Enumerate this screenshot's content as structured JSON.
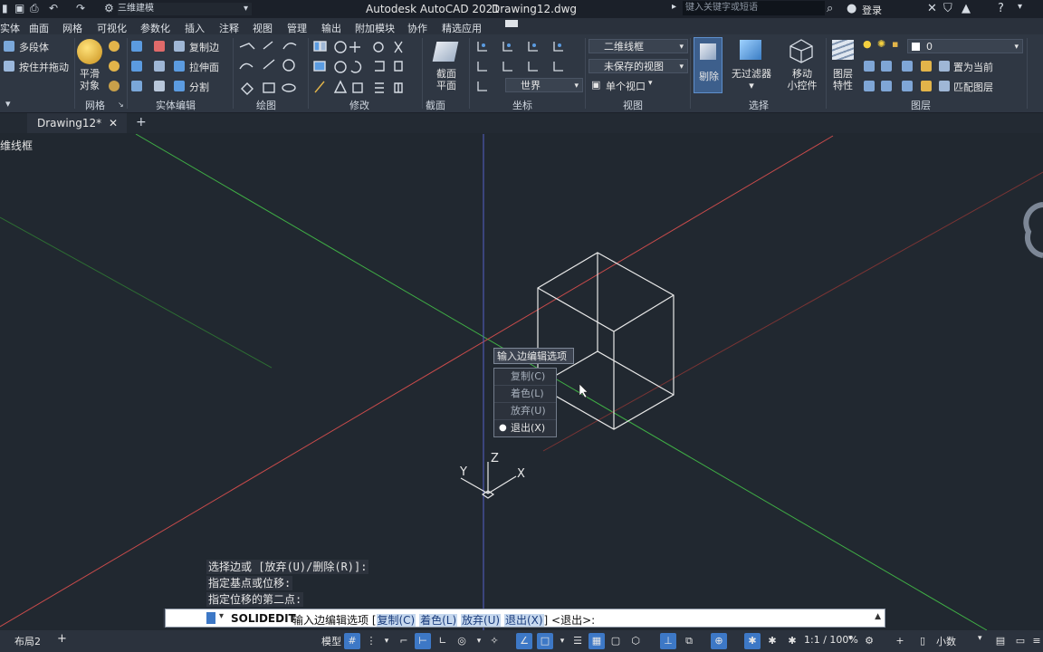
{
  "titlebar": {
    "workspace": "三维建模",
    "app_title": "Autodesk AutoCAD 2021",
    "document": "Drawing12.dwg",
    "search_placeholder": "键入关键字或短语",
    "login": "登录"
  },
  "menu_tabs": [
    "实体",
    "曲面",
    "网格",
    "可视化",
    "参数化",
    "插入",
    "注释",
    "视图",
    "管理",
    "输出",
    "附加模块",
    "协作",
    "精选应用"
  ],
  "ribbon": {
    "panel1": {
      "item1": "多段体",
      "item2": "按住并拖动"
    },
    "mesh": {
      "button_line1": "平滑",
      "button_line2": "对象",
      "title": "网格"
    },
    "solid_edit": {
      "copy_edge": "复制边",
      "extrude_face": "拉伸面",
      "split": "分割",
      "title": "实体编辑"
    },
    "draw_title": "绘图",
    "modify_title": "修改",
    "section": {
      "button_line1": "截面",
      "button_line2": "平面",
      "title": "截面"
    },
    "coords": {
      "ucs_value": "世界",
      "title": "坐标"
    },
    "view": {
      "visual_style": "二维线框",
      "saved_view": "未保存的视图",
      "viewport": "单个视口",
      "title": "视图"
    },
    "selection": {
      "cull": "剔除",
      "no_filter": "无过滤器",
      "gizmo_line1": "移动",
      "gizmo_line2": "小控件",
      "title": "选择"
    },
    "layers": {
      "props_line1": "图层",
      "props_line2": "特性",
      "layer_value": "0",
      "set_current": "置为当前",
      "match_layer": "匹配图层",
      "title": "图层"
    }
  },
  "file_tab": {
    "name": "Drawing12*",
    "new_tab": "+"
  },
  "viewport": {
    "label": "维线框"
  },
  "axes": {
    "x": "X",
    "y": "Y",
    "z": "Z"
  },
  "context_menu": {
    "title": "输入边编辑选项",
    "items": [
      {
        "label": "复制(C)"
      },
      {
        "label": "着色(L)"
      },
      {
        "label": "放弃(U)"
      },
      {
        "label": "退出(X)"
      }
    ],
    "selected_marker": "●"
  },
  "command_history": [
    "选择边或 [放弃(U)/删除(R)]:",
    "指定基点或位移:",
    "指定位移的第二点:"
  ],
  "command_line": {
    "command": "SOLIDEDIT",
    "prompt": "输入边编辑选项 [",
    "opt_copy": "复制(C)",
    "opt_color": "着色(L)",
    "opt_undo": "放弃(U)",
    "opt_exit": "退出(X)",
    "suffix": "] <退出>:"
  },
  "status": {
    "layout_tab": "布局2",
    "add": "+",
    "model": "模型",
    "scale": "1:1 / 100%",
    "units": "小数"
  },
  "colors": {
    "background": "#212830",
    "ribbon": "#2f3743",
    "x_axis": "#c94b4b",
    "y_axis": "#3fae45",
    "z_axis": "#5560c8",
    "accent": "#3d78c6"
  }
}
